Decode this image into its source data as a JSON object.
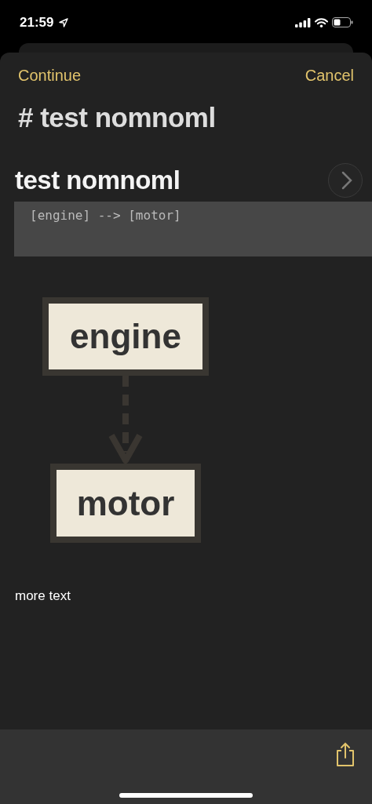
{
  "status_bar": {
    "time": "21:59"
  },
  "nav": {
    "left": "Continue",
    "right": "Cancel"
  },
  "title": "# test nomnoml",
  "note": {
    "heading": "test nomnoml",
    "code": "[engine] --> [motor]",
    "diagram": {
      "nodes": [
        {
          "label": "engine"
        },
        {
          "label": "motor"
        }
      ]
    },
    "text": "more text"
  }
}
